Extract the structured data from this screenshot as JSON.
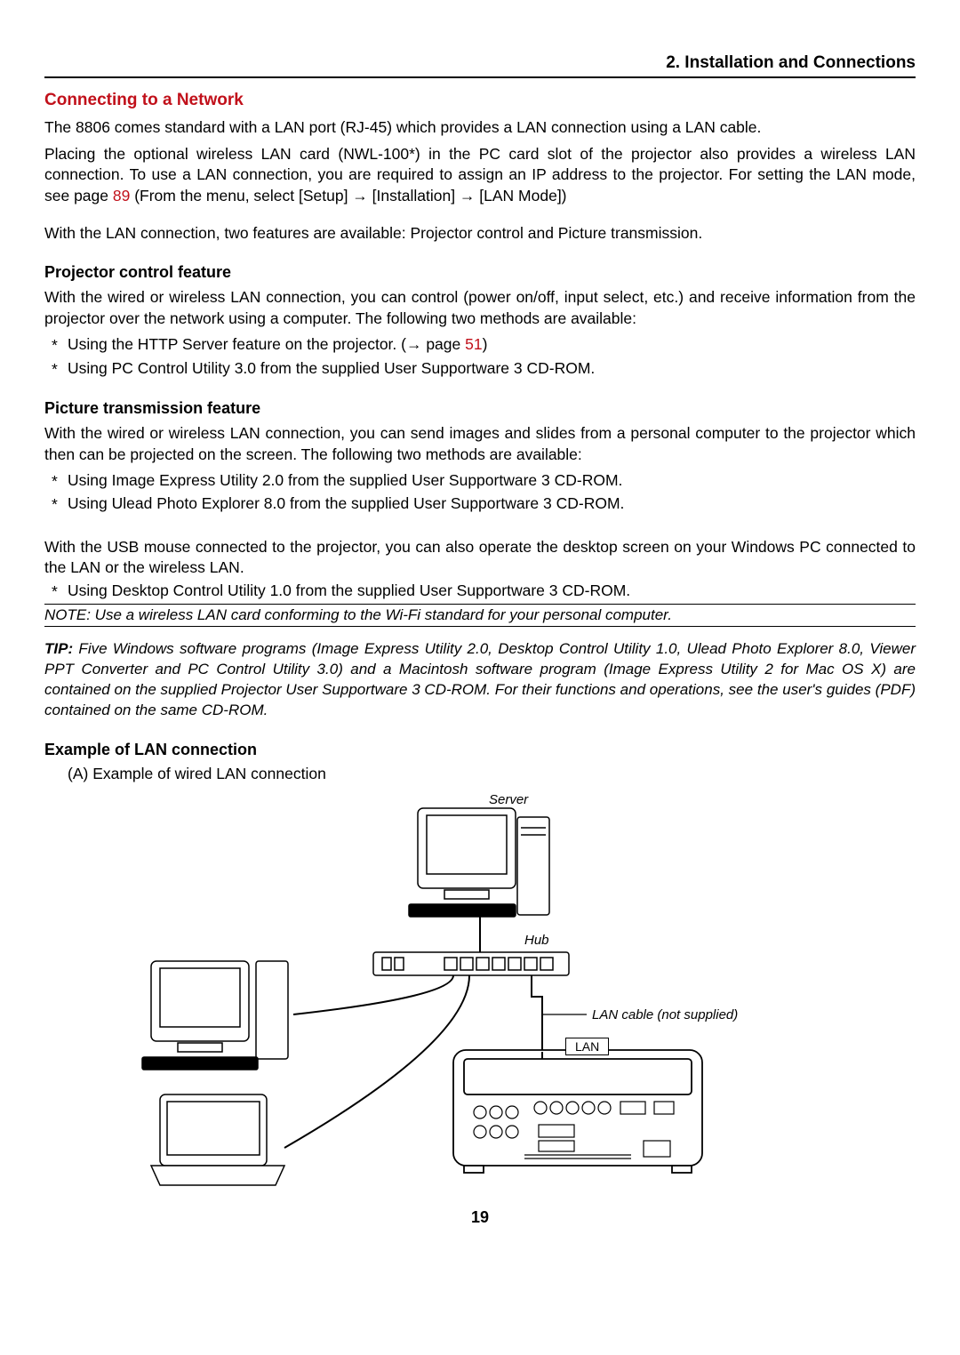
{
  "header": "2. Installation and Connections",
  "section_title": "Connecting to a Network",
  "intro": {
    "p1a": "The 8806 comes standard with a LAN port (RJ-45) which provides a LAN connection using a LAN cable.",
    "p1b": "Placing the optional wireless LAN card (NWL-100*) in the PC card slot of the projector also provides a wireless LAN connection. To use a LAN connection, you are required to assign an IP address to the projector. For setting the LAN mode, see page ",
    "link89": "89",
    "p1c": " (From the menu, select [Setup] → [Installation] → [LAN Mode])",
    "p2": "With the LAN connection, two features are available: Projector control and Picture transmission."
  },
  "projector": {
    "heading": "Projector control feature",
    "text": "With the wired or wireless LAN connection, you can control (power on/off, input select, etc.) and receive information from the projector over the network using a computer. The following two methods are available:",
    "b1a": "Using the HTTP Server feature on the projector. (→ page ",
    "b1link": "51",
    "b1b": ")",
    "b2": "Using PC Control Utility 3.0 from the supplied User Supportware 3 CD-ROM."
  },
  "picture": {
    "heading": "Picture transmission feature",
    "text": "With the wired or wireless LAN connection, you can send images and slides from a personal computer to the projector which then can be projected on the screen. The following two methods are available:",
    "b1": "Using Image Express Utility 2.0 from the supplied User Supportware 3 CD-ROM.",
    "b2": "Using Ulead Photo Explorer 8.0 from the supplied User Supportware 3 CD-ROM."
  },
  "usb": {
    "text": "With the USB mouse connected to the projector, you can also operate the desktop screen on your Windows PC connected to the LAN or the wireless LAN.",
    "b1": "Using Desktop Control Utility 1.0 from the supplied User Supportware 3 CD-ROM."
  },
  "note": "NOTE: Use a wireless LAN card conforming to the Wi-Fi standard for your personal computer.",
  "tip": {
    "label": "TIP:",
    "text": " Five Windows software programs (Image Express Utility 2.0, Desktop Control Utility 1.0, Ulead Photo Explorer 8.0, Viewer PPT Converter and PC Control Utility 3.0) and a Macintosh software program (Image Express Utility 2 for Mac OS X) are contained on the supplied Projector User Supportware 3 CD-ROM. For their functions and operations, see the user's guides (PDF) contained on the same CD-ROM."
  },
  "example": {
    "heading": "Example of LAN connection",
    "sub": "(A) Example of wired LAN connection"
  },
  "diagram": {
    "server": "Server",
    "hub": "Hub",
    "lan_cable": "LAN cable (not supplied)",
    "lan": "LAN"
  },
  "page_number": "19"
}
